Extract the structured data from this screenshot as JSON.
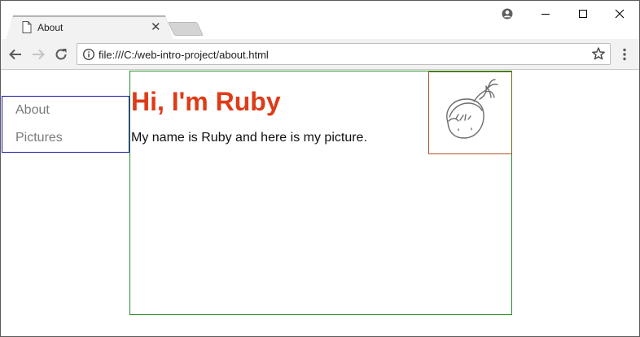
{
  "browser": {
    "tab": {
      "title": "About",
      "icon": "document-icon",
      "close_glyph": "✕"
    },
    "new_tab_icon": "new-tab-icon",
    "window_controls": [
      "profile-icon",
      "minimize-icon",
      "maximize-icon",
      "close-icon"
    ],
    "nav_buttons": [
      "back-icon",
      "forward-icon",
      "reload-icon"
    ],
    "address_bar": {
      "url": "file:///C:/web-intro-project/about.html",
      "leading_icon": "info-icon",
      "trailing_icon": "star-icon"
    },
    "menu_icon": "more-vertical-icon"
  },
  "page": {
    "nav": {
      "items": [
        {
          "label": "About"
        },
        {
          "label": "Pictures"
        }
      ]
    },
    "heading": "Hi, I'm Ruby",
    "intro": "My name is Ruby and here is my picture.",
    "picture": {
      "icon": "ruby-avatar-drawing"
    }
  },
  "colors": {
    "heading": "#de3b18",
    "nav_link": "#7a7a7a",
    "sidebar_border": "#1a1aa6",
    "main_border": "#2a8a2a",
    "picture_border": "#b0542c"
  }
}
